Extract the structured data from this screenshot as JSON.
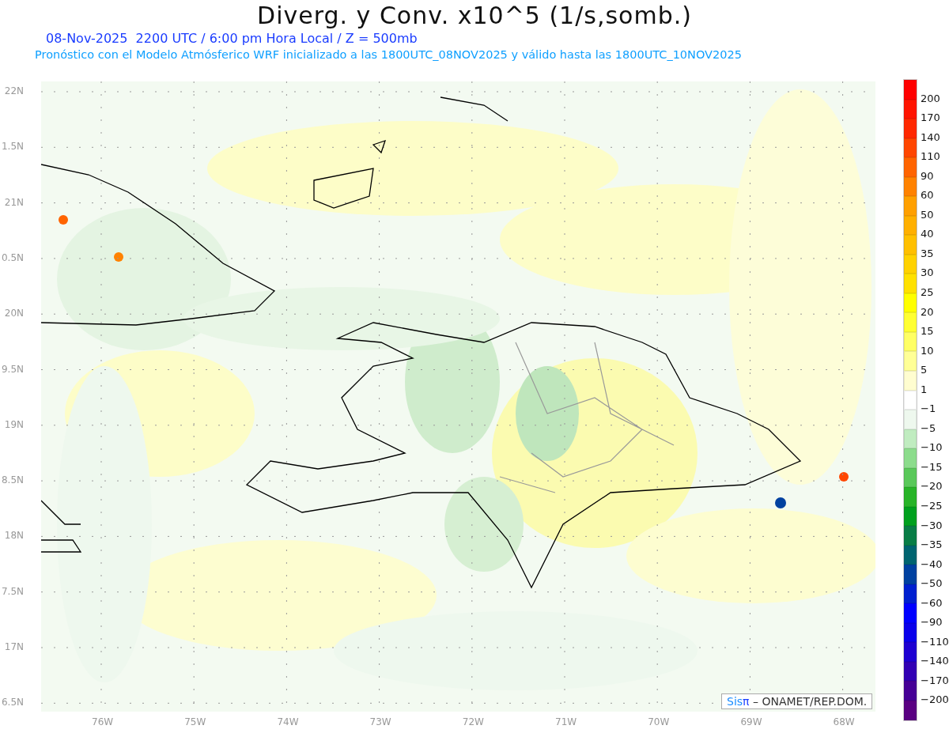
{
  "title": "Diverg. y Conv. x10^5 (1/s,somb.)",
  "subtitle": "08-Nov-2025  2200 UTC / 6:00 pm Hora Local / Z = 500mb",
  "description": "Pronóstico con el Modelo Atmósferico WRF inicializado a las 1800UTC_08NOV2025 y válido hasta las  1800UTC_10NOV2025",
  "map": {
    "y_ticks": [
      "22N",
      "1.5N",
      "21N",
      "0.5N",
      "20N",
      "9.5N",
      "19N",
      "8.5N",
      "18N",
      "7.5N",
      "17N",
      "6.5N"
    ],
    "x_ticks": [
      "76W",
      "75W",
      "74W",
      "73W",
      "72W",
      "71W",
      "70W",
      "69W",
      "68W"
    ],
    "credit": {
      "brand": "Sis",
      "symbol": "π",
      "text": "– ONAMET/REP.DOM."
    }
  },
  "colorbar": [
    {
      "color": "#ff0000",
      "label": "200"
    },
    {
      "color": "#ff1400",
      "label": "170"
    },
    {
      "color": "#ff2800",
      "label": "140"
    },
    {
      "color": "#ff4600",
      "label": "110"
    },
    {
      "color": "#ff6400",
      "label": "90"
    },
    {
      "color": "#ff8200",
      "label": "60"
    },
    {
      "color": "#ffa000",
      "label": "50"
    },
    {
      "color": "#ffb000",
      "label": "40"
    },
    {
      "color": "#ffc000",
      "label": "35"
    },
    {
      "color": "#ffd200",
      "label": "30"
    },
    {
      "color": "#ffe100",
      "label": "25"
    },
    {
      "color": "#ffff00",
      "label": "20"
    },
    {
      "color": "#ffff32",
      "label": "15"
    },
    {
      "color": "#ffff64",
      "label": "10"
    },
    {
      "color": "#ffff96",
      "label": "5"
    },
    {
      "color": "#fffdd0",
      "label": "1"
    },
    {
      "color": "#ffffff",
      "label": "−1"
    },
    {
      "color": "#eef8ee",
      "label": "−5"
    },
    {
      "color": "#c0ecc0",
      "label": "−10"
    },
    {
      "color": "#8cdc8c",
      "label": "−15"
    },
    {
      "color": "#5ac85a",
      "label": "−20"
    },
    {
      "color": "#28b428",
      "label": "−25"
    },
    {
      "color": "#00a01e",
      "label": "−30"
    },
    {
      "color": "#087d46",
      "label": "−35"
    },
    {
      "color": "#006470",
      "label": "−40"
    },
    {
      "color": "#0041a0",
      "label": "−50"
    },
    {
      "color": "#0020d0",
      "label": "−60"
    },
    {
      "color": "#0000ff",
      "label": "−90"
    },
    {
      "color": "#0a00eb",
      "label": "−110"
    },
    {
      "color": "#1e00d2",
      "label": "−140"
    },
    {
      "color": "#3200b4",
      "label": "−170"
    },
    {
      "color": "#460096",
      "label": "−200"
    },
    {
      "color": "#5a0082"
    }
  ]
}
